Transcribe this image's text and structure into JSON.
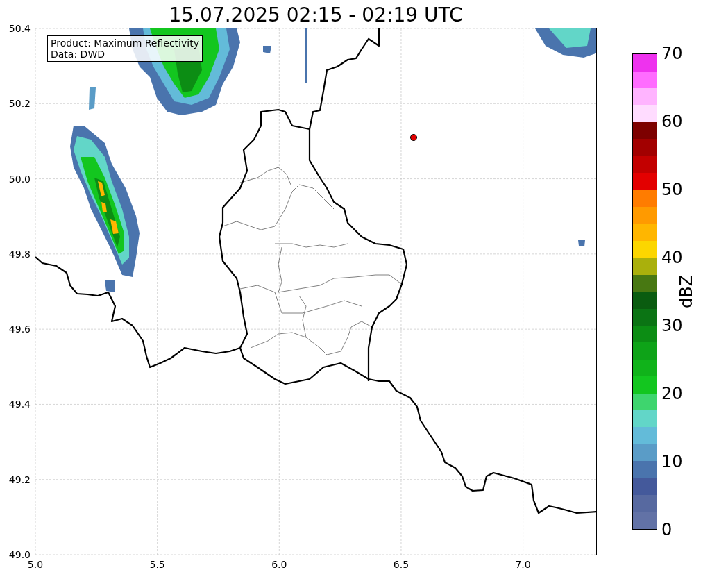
{
  "title": "15.07.2025 02:15 - 02:19 UTC",
  "map": {
    "info_box": [
      "Product: Maximum Reflectivity",
      "Data: DWD"
    ],
    "xticks": [
      "5.0",
      "5.5",
      "6.0",
      "6.5",
      "7.0"
    ],
    "yticks": [
      "50.4",
      "50.2",
      "50.0",
      "49.8",
      "49.6",
      "49.4",
      "49.2",
      "49.0"
    ]
  },
  "colorbar": {
    "label": "dBZ",
    "ticks": [
      "70",
      "60",
      "50",
      "40",
      "30",
      "20",
      "10",
      "0"
    ],
    "steps": [
      {
        "color": "#6272a6"
      },
      {
        "color": "#5769a0"
      },
      {
        "color": "#44599b"
      },
      {
        "color": "#4a74ad"
      },
      {
        "color": "#5a9cc7"
      },
      {
        "color": "#63bbd9"
      },
      {
        "color": "#62d6c8"
      },
      {
        "color": "#3ed56e"
      },
      {
        "color": "#13c61f"
      },
      {
        "color": "#10b31a"
      },
      {
        "color": "#0ea318"
      },
      {
        "color": "#0c8d14"
      },
      {
        "color": "#0b7414"
      },
      {
        "color": "#0a5c10"
      },
      {
        "color": "#487812"
      },
      {
        "color": "#aab00c"
      },
      {
        "color": "#fcd600"
      },
      {
        "color": "#ffb600"
      },
      {
        "color": "#ff9a00"
      },
      {
        "color": "#ff7c00"
      },
      {
        "color": "#e30000"
      },
      {
        "color": "#c30000"
      },
      {
        "color": "#a20000"
      },
      {
        "color": "#7d0000"
      },
      {
        "color": "#ffdcff"
      },
      {
        "color": "#ffb4ff"
      },
      {
        "color": "#ff6cff"
      },
      {
        "color": "#ee32ee"
      }
    ]
  }
}
